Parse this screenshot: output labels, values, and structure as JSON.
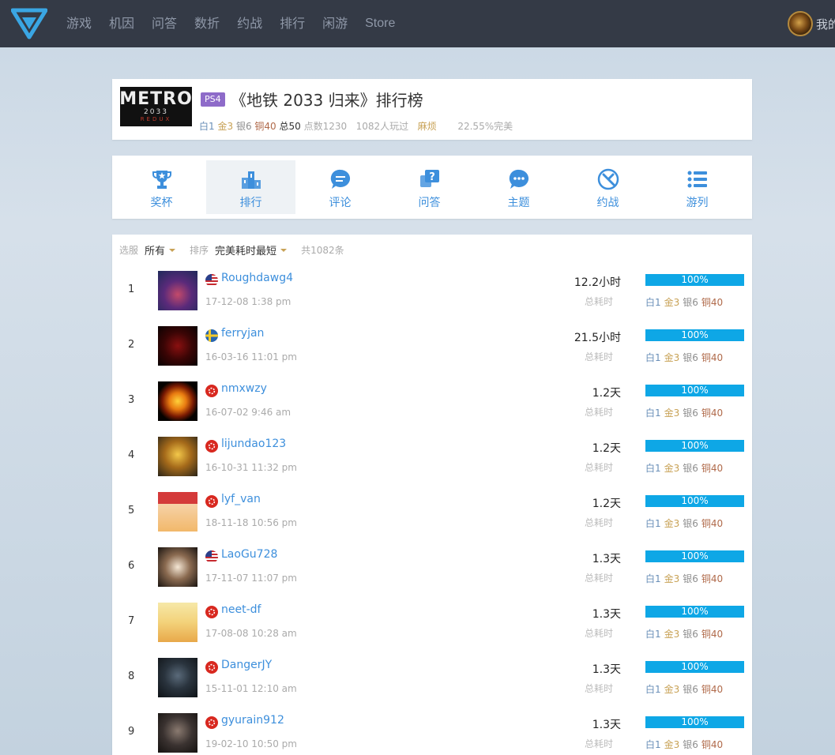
{
  "nav": {
    "items": [
      "游戏",
      "机因",
      "问答",
      "数折",
      "约战",
      "排行",
      "闲游",
      "Store"
    ],
    "user_label": "我的"
  },
  "game": {
    "cover": {
      "line1": "METRO",
      "line2": "2033",
      "line3": "REDUX"
    },
    "platform": "PS4",
    "title": "《地铁 2033 归来》排行榜",
    "stats": {
      "platinum": "白1",
      "gold": "金3",
      "silver": "银6",
      "bronze": "铜40",
      "total": "总50",
      "points": "点数1230",
      "players": "1082人玩过",
      "difficulty": "麻烦",
      "perfect_rate": "22.55%完美"
    }
  },
  "tabs": [
    {
      "label": "奖杯",
      "icon": "trophy-icon"
    },
    {
      "label": "排行",
      "icon": "podium-icon"
    },
    {
      "label": "评论",
      "icon": "comment-icon"
    },
    {
      "label": "问答",
      "icon": "question-icon"
    },
    {
      "label": "主题",
      "icon": "topic-icon"
    },
    {
      "label": "约战",
      "icon": "battle-icon"
    },
    {
      "label": "游列",
      "icon": "list-icon"
    }
  ],
  "filter": {
    "select_label": "选服",
    "select_value": "所有",
    "sort_label": "排序",
    "sort_value": "完美耗时最短",
    "count": "共1082条"
  },
  "colors": {
    "accent": "#3d8fdc",
    "progress": "#0ea7e6",
    "platform_badge": "#8e6bc9",
    "topbar": "#343a46"
  },
  "time_label": "总耗时",
  "rows": [
    {
      "rank": "1",
      "name": "Roughdawg4",
      "flag": "us",
      "date": "17-12-08 1:38 pm",
      "time": "12.2小时",
      "progress": 100,
      "progress_text": "100%",
      "platinum": "白1",
      "gold": "金3",
      "silver": "银6",
      "bronze": "铜40",
      "avatar": "wizard"
    },
    {
      "rank": "2",
      "name": "ferryjan",
      "flag": "se",
      "date": "16-03-16 11:01 pm",
      "time": "21.5小时",
      "progress": 100,
      "progress_text": "100%",
      "platinum": "白1",
      "gold": "金3",
      "silver": "银6",
      "bronze": "铜40",
      "avatar": "dark-red"
    },
    {
      "rank": "3",
      "name": "nmxwzy",
      "flag": "hk",
      "date": "16-07-02 9:46 am",
      "time": "1.2天",
      "progress": 100,
      "progress_text": "100%",
      "platinum": "白1",
      "gold": "金3",
      "silver": "银6",
      "bronze": "铜40",
      "avatar": "yin-yang"
    },
    {
      "rank": "4",
      "name": "lijundao123",
      "flag": "hk",
      "date": "16-10-31 11:32 pm",
      "time": "1.2天",
      "progress": 100,
      "progress_text": "100%",
      "platinum": "白1",
      "gold": "金3",
      "silver": "银6",
      "bronze": "铜40",
      "avatar": "gold-skull"
    },
    {
      "rank": "5",
      "name": "lyf_van",
      "flag": "hk",
      "date": "18-11-18 10:56 pm",
      "time": "1.2天",
      "progress": 100,
      "progress_text": "100%",
      "platinum": "白1",
      "gold": "金3",
      "silver": "银6",
      "bronze": "铜40",
      "avatar": "anime-girl"
    },
    {
      "rank": "6",
      "name": "LaoGu728",
      "flag": "us",
      "date": "17-11-07 11:07 pm",
      "time": "1.3天",
      "progress": 100,
      "progress_text": "100%",
      "platinum": "白1",
      "gold": "金3",
      "silver": "银6",
      "bronze": "铜40",
      "avatar": "anime-boy"
    },
    {
      "rank": "7",
      "name": "neet-df",
      "flag": "hk",
      "date": "17-08-08 10:28 am",
      "time": "1.3天",
      "progress": 100,
      "progress_text": "100%",
      "platinum": "白1",
      "gold": "金3",
      "silver": "银6",
      "bronze": "铜40",
      "avatar": "blonde"
    },
    {
      "rank": "8",
      "name": "DangerJY",
      "flag": "hk",
      "date": "15-11-01 12:10 am",
      "time": "1.3天",
      "progress": 100,
      "progress_text": "100%",
      "platinum": "白1",
      "gold": "金3",
      "silver": "银6",
      "bronze": "铜40",
      "avatar": "dark-face"
    },
    {
      "rank": "9",
      "name": "gyurain912",
      "flag": "hk",
      "date": "19-02-10 10:50 pm",
      "time": "1.3天",
      "progress": 100,
      "progress_text": "100%",
      "platinum": "白1",
      "gold": "金3",
      "silver": "银6",
      "bronze": "铜40",
      "avatar": "assassin"
    }
  ]
}
